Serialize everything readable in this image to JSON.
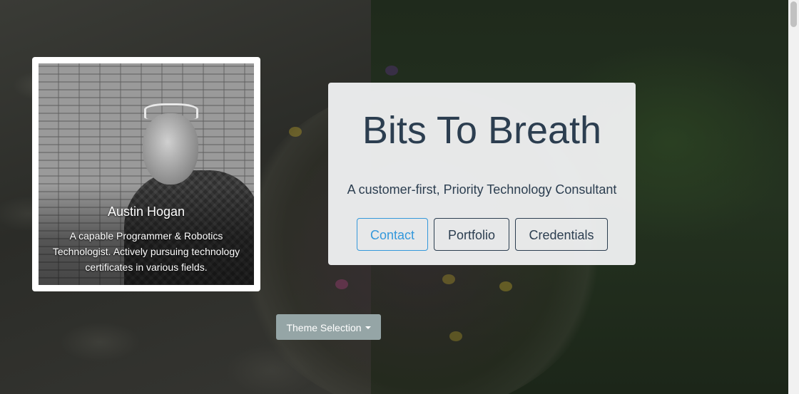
{
  "profile": {
    "name": "Austin Hogan",
    "bio": "A capable Programmer & Robotics Technologist. Actively pursuing technology certificates in various fields."
  },
  "hero": {
    "title": "Bits To Breath",
    "tagline": "A customer-first, Priority Technology Consultant",
    "buttons": {
      "contact": "Contact",
      "portfolio": "Portfolio",
      "credentials": "Credentials"
    }
  },
  "theme_selector": {
    "label": "Theme Selection",
    "icon": "caret-down-icon"
  },
  "colors": {
    "primary_text": "#2c3e50",
    "accent": "#3498db",
    "theme_button": "#95a5a6",
    "hero_background": "#f1f2f3"
  }
}
